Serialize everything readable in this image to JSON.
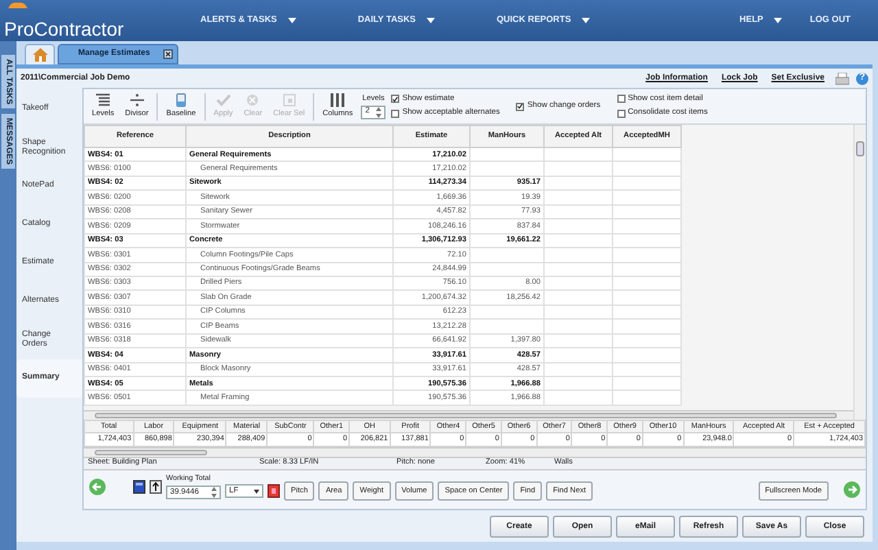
{
  "app": {
    "logo": "ProContractor",
    "menu": [
      {
        "label": "ALERTS & TASKS",
        "dropdown": true
      },
      {
        "label": "DAILY TASKS",
        "dropdown": true
      },
      {
        "label": "QUICK REPORTS",
        "dropdown": true
      }
    ],
    "menu_right": [
      {
        "label": "HELP",
        "dropdown": true
      },
      {
        "label": "LOG OUT",
        "dropdown": false
      }
    ]
  },
  "side_tabs": [
    "ALL TASKS",
    "MESSAGES"
  ],
  "tabs": [
    {
      "label": "Manage Estimates",
      "selected": true
    }
  ],
  "job": {
    "path": "2011\\Commercial Job Demo",
    "links": [
      "Job Information",
      "Lock Job",
      "Set Exclusive"
    ],
    "help": "?"
  },
  "sidebar": {
    "items": [
      {
        "label": "Takeoff",
        "selected": false
      },
      {
        "label": "Shape Recognition",
        "selected": false
      },
      {
        "label": "NotePad",
        "selected": false
      },
      {
        "label": "Catalog",
        "selected": false
      },
      {
        "label": "Estimate",
        "selected": false
      },
      {
        "label": "Alternates",
        "selected": false
      },
      {
        "label": "Change Orders",
        "selected": false
      },
      {
        "label": "Summary",
        "selected": true
      }
    ]
  },
  "toolbar": {
    "buttons": [
      {
        "label": "Levels",
        "disabled": false
      },
      {
        "label": "Divisor",
        "disabled": false
      },
      {
        "label": "Baseline",
        "disabled": false
      },
      {
        "label": "Apply",
        "disabled": true
      },
      {
        "label": "Clear",
        "disabled": true
      },
      {
        "label": "Clear Sel",
        "disabled": true
      },
      {
        "label": "Columns",
        "disabled": false
      }
    ],
    "levels": {
      "label": "Levels",
      "value": "2"
    },
    "options": [
      {
        "label": "Show estimate",
        "checked": true
      },
      {
        "label": "Show acceptable alternates",
        "checked": false
      },
      {
        "label": "Show change orders",
        "checked": true
      },
      {
        "label": "Show cost item detail",
        "checked": false
      },
      {
        "label": "Consolidate cost items",
        "checked": false
      }
    ]
  },
  "table": {
    "columns": [
      "Reference",
      "Description",
      "Estimate",
      "ManHours",
      "Accepted Alt",
      "AcceptedMH"
    ],
    "rows": [
      {
        "kind": "group",
        "cells": [
          "WBS4: 01",
          "General Requirements",
          "17,210.02",
          "",
          "",
          ""
        ]
      },
      {
        "kind": "item",
        "cells": [
          "WBS6: 0100",
          "General Requirements",
          "17,210.02",
          "",
          "",
          ""
        ]
      },
      {
        "kind": "group",
        "cells": [
          "WBS4: 02",
          "Sitework",
          "114,273.34",
          "935.17",
          "",
          ""
        ]
      },
      {
        "kind": "item",
        "cells": [
          "WBS6: 0200",
          "Sitework",
          "1,669.36",
          "19.39",
          "",
          ""
        ]
      },
      {
        "kind": "item",
        "cells": [
          "WBS6: 0208",
          "Sanitary Sewer",
          "4,457.82",
          "77.93",
          "",
          ""
        ]
      },
      {
        "kind": "item",
        "cells": [
          "WBS6: 0209",
          "Stormwater",
          "108,246.16",
          "837.84",
          "",
          ""
        ]
      },
      {
        "kind": "group",
        "cells": [
          "WBS4: 03",
          "Concrete",
          "1,306,712.93",
          "19,661.22",
          "",
          ""
        ]
      },
      {
        "kind": "item",
        "cells": [
          "WBS6: 0301",
          "Column Footings/Pile Caps",
          "72.10",
          "",
          "",
          ""
        ]
      },
      {
        "kind": "item",
        "cells": [
          "WBS6: 0302",
          "Continuous Footings/Grade Beams",
          "24,844.99",
          "",
          "",
          ""
        ]
      },
      {
        "kind": "item",
        "cells": [
          "WBS6: 0303",
          "Drilled Piers",
          "756.10",
          "8.00",
          "",
          ""
        ]
      },
      {
        "kind": "item",
        "cells": [
          "WBS6: 0307",
          "Slab On Grade",
          "1,200,674.32",
          "18,256.42",
          "",
          ""
        ]
      },
      {
        "kind": "item",
        "cells": [
          "WBS6: 0310",
          "CIP Columns",
          "612.23",
          "",
          "",
          ""
        ]
      },
      {
        "kind": "item",
        "cells": [
          "WBS6: 0316",
          "CIP Beams",
          "13,212.28",
          "",
          "",
          ""
        ]
      },
      {
        "kind": "item",
        "cells": [
          "WBS6: 0318",
          "Sidewalk",
          "66,641.92",
          "1,397.80",
          "",
          ""
        ]
      },
      {
        "kind": "group",
        "cells": [
          "WBS4: 04",
          "Masonry",
          "33,917.61",
          "428.57",
          "",
          ""
        ]
      },
      {
        "kind": "item",
        "cells": [
          "WBS6: 0401",
          "Block Masonry",
          "33,917.61",
          "428.57",
          "",
          ""
        ]
      },
      {
        "kind": "group",
        "cells": [
          "WBS4: 05",
          "Metals",
          "190,575.36",
          "1,966.88",
          "",
          ""
        ]
      },
      {
        "kind": "item",
        "cells": [
          "WBS6: 0501",
          "Metal Framing",
          "190,575.36",
          "1,966.88",
          "",
          ""
        ]
      }
    ]
  },
  "totals": {
    "columns": [
      "Total",
      "Labor",
      "Equipment",
      "Material",
      "SubContr",
      "Other1",
      "OH",
      "Profit",
      "Other4",
      "Other5",
      "Other6",
      "Other7",
      "Other8",
      "Other9",
      "Other10",
      "ManHours",
      "Accepted Alt",
      "Est + Accepted"
    ],
    "values": [
      "1,724,403",
      "860,898",
      "230,394",
      "288,409",
      "0",
      "0",
      "206,821",
      "137,881",
      "0",
      "0",
      "0",
      "0",
      "0",
      "0",
      "0",
      "23,948.0",
      "0",
      "1,724,403"
    ]
  },
  "status_bar": [
    "Sheet: Building Plan",
    "Scale: 8.33  LF/IN",
    "Pitch: none",
    "Zoom: 41%",
    "Walls"
  ],
  "takeoff_tools": {
    "working_total_label": "Working Total",
    "value": "39.9446",
    "unit": "LF",
    "buttons": [
      "Pitch",
      "Area",
      "Weight",
      "Volume",
      "Space on Center",
      "Find",
      "Find Next"
    ],
    "fullscreen": "Fullscreen Mode"
  },
  "actions": [
    "Create",
    "Open",
    "eMail",
    "Refresh",
    "Save As",
    "Close"
  ]
}
